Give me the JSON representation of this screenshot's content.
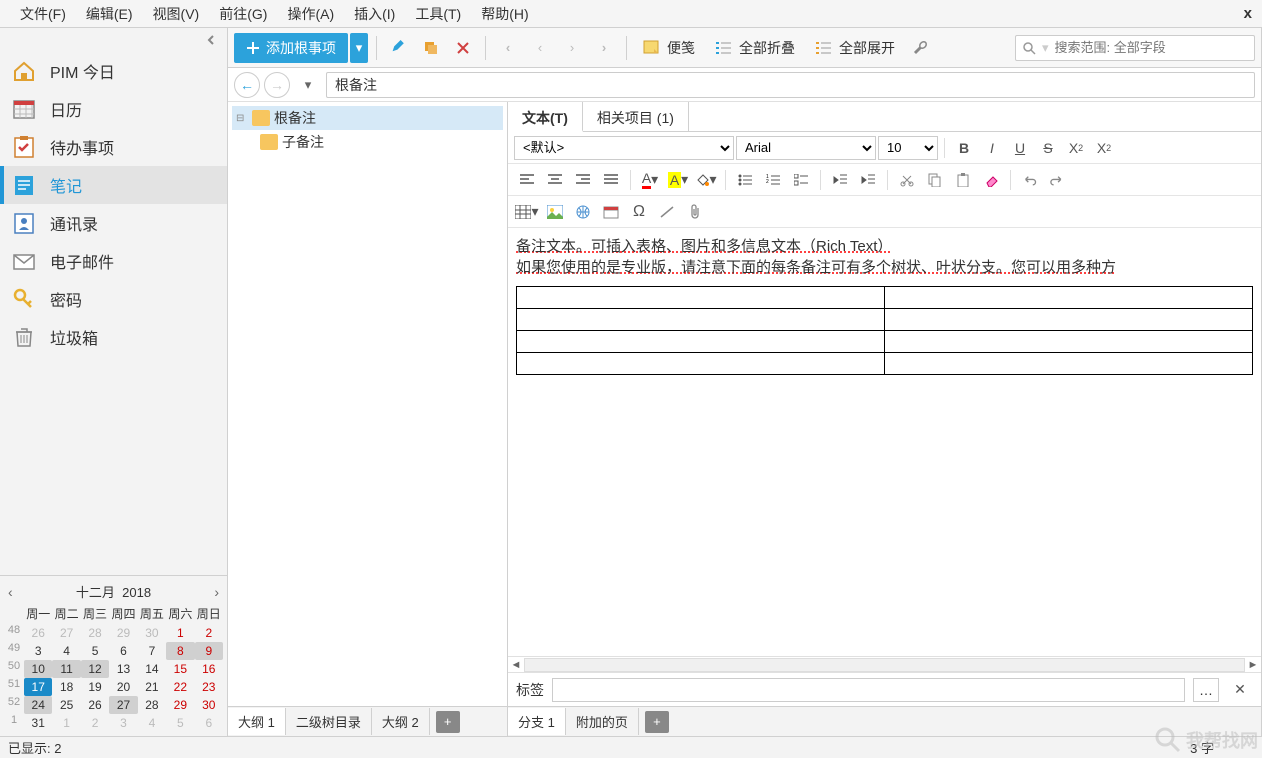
{
  "menubar": {
    "items": [
      "文件(F)",
      "编辑(E)",
      "视图(V)",
      "前往(G)",
      "操作(A)",
      "插入(I)",
      "工具(T)",
      "帮助(H)"
    ],
    "close": "x"
  },
  "sidebar": {
    "items": [
      {
        "label": "PIM 今日",
        "icon": "home"
      },
      {
        "label": "日历",
        "icon": "calendar"
      },
      {
        "label": "待办事项",
        "icon": "todo"
      },
      {
        "label": "笔记",
        "icon": "note",
        "active": true
      },
      {
        "label": "通讯录",
        "icon": "contacts"
      },
      {
        "label": "电子邮件",
        "icon": "mail"
      },
      {
        "label": "密码",
        "icon": "key"
      },
      {
        "label": "垃圾箱",
        "icon": "trash"
      }
    ]
  },
  "calendar": {
    "month": "十二月",
    "year": "2018",
    "dow": [
      "周一",
      "周二",
      "周三",
      "周四",
      "周五",
      "周六",
      "周日"
    ],
    "weeks": [
      {
        "wk": "48",
        "days": [
          {
            "d": "26",
            "o": true
          },
          {
            "d": "27",
            "o": true
          },
          {
            "d": "28",
            "o": true
          },
          {
            "d": "29",
            "o": true
          },
          {
            "d": "30",
            "o": true
          },
          {
            "d": "1",
            "we": true
          },
          {
            "d": "2",
            "we": true
          }
        ]
      },
      {
        "wk": "49",
        "days": [
          {
            "d": "3"
          },
          {
            "d": "4"
          },
          {
            "d": "5"
          },
          {
            "d": "6"
          },
          {
            "d": "7"
          },
          {
            "d": "8",
            "we": true,
            "sel": true
          },
          {
            "d": "9",
            "we": true,
            "sel": true
          }
        ]
      },
      {
        "wk": "50",
        "days": [
          {
            "d": "10",
            "sel": true
          },
          {
            "d": "11",
            "sel": true
          },
          {
            "d": "12",
            "sel": true
          },
          {
            "d": "13"
          },
          {
            "d": "14"
          },
          {
            "d": "15",
            "we": true
          },
          {
            "d": "16",
            "we": true
          }
        ]
      },
      {
        "wk": "51",
        "days": [
          {
            "d": "17",
            "today": true
          },
          {
            "d": "18"
          },
          {
            "d": "19"
          },
          {
            "d": "20"
          },
          {
            "d": "21"
          },
          {
            "d": "22",
            "we": true
          },
          {
            "d": "23",
            "we": true
          }
        ]
      },
      {
        "wk": "52",
        "days": [
          {
            "d": "24",
            "sel": true
          },
          {
            "d": "25"
          },
          {
            "d": "26"
          },
          {
            "d": "27",
            "sel": true
          },
          {
            "d": "28"
          },
          {
            "d": "29",
            "we": true
          },
          {
            "d": "30",
            "we": true
          }
        ]
      },
      {
        "wk": "1",
        "days": [
          {
            "d": "31"
          },
          {
            "d": "1",
            "o": true
          },
          {
            "d": "2",
            "o": true
          },
          {
            "d": "3",
            "o": true
          },
          {
            "d": "4",
            "o": true
          },
          {
            "d": "5",
            "o": true,
            "we": true
          },
          {
            "d": "6",
            "o": true,
            "we": true
          }
        ]
      }
    ]
  },
  "toolbar": {
    "add_root": "添加根事项",
    "sticky": "便笺",
    "collapse_all": "全部折叠",
    "expand_all": "全部展开",
    "search_placeholder": "搜索范围: 全部字段"
  },
  "breadcrumb": {
    "path": "根备注"
  },
  "tree": {
    "root": "根备注",
    "child": "子备注",
    "tabs": [
      "大纲 1",
      "二级树目录",
      "大纲 2"
    ]
  },
  "editor": {
    "tabs": {
      "text": "文本(T)",
      "related": "相关项目  (1)"
    },
    "style_default": "<默认>",
    "font": "Arial",
    "size": "10",
    "body_line1": "备注文本。可插入表格、图片和多信息文本（Rich Text）",
    "body_line2": "如果您使用的是专业版，请注意下面的每条备注可有多个树状、叶状分支。您可以用多种方",
    "tag_label": "标签",
    "tag_more": "…",
    "branch_tabs": [
      "分支 1",
      "附加的页"
    ]
  },
  "statusbar": {
    "left": "已显示:  2",
    "right": "3 字"
  },
  "watermark": "我帮找网"
}
